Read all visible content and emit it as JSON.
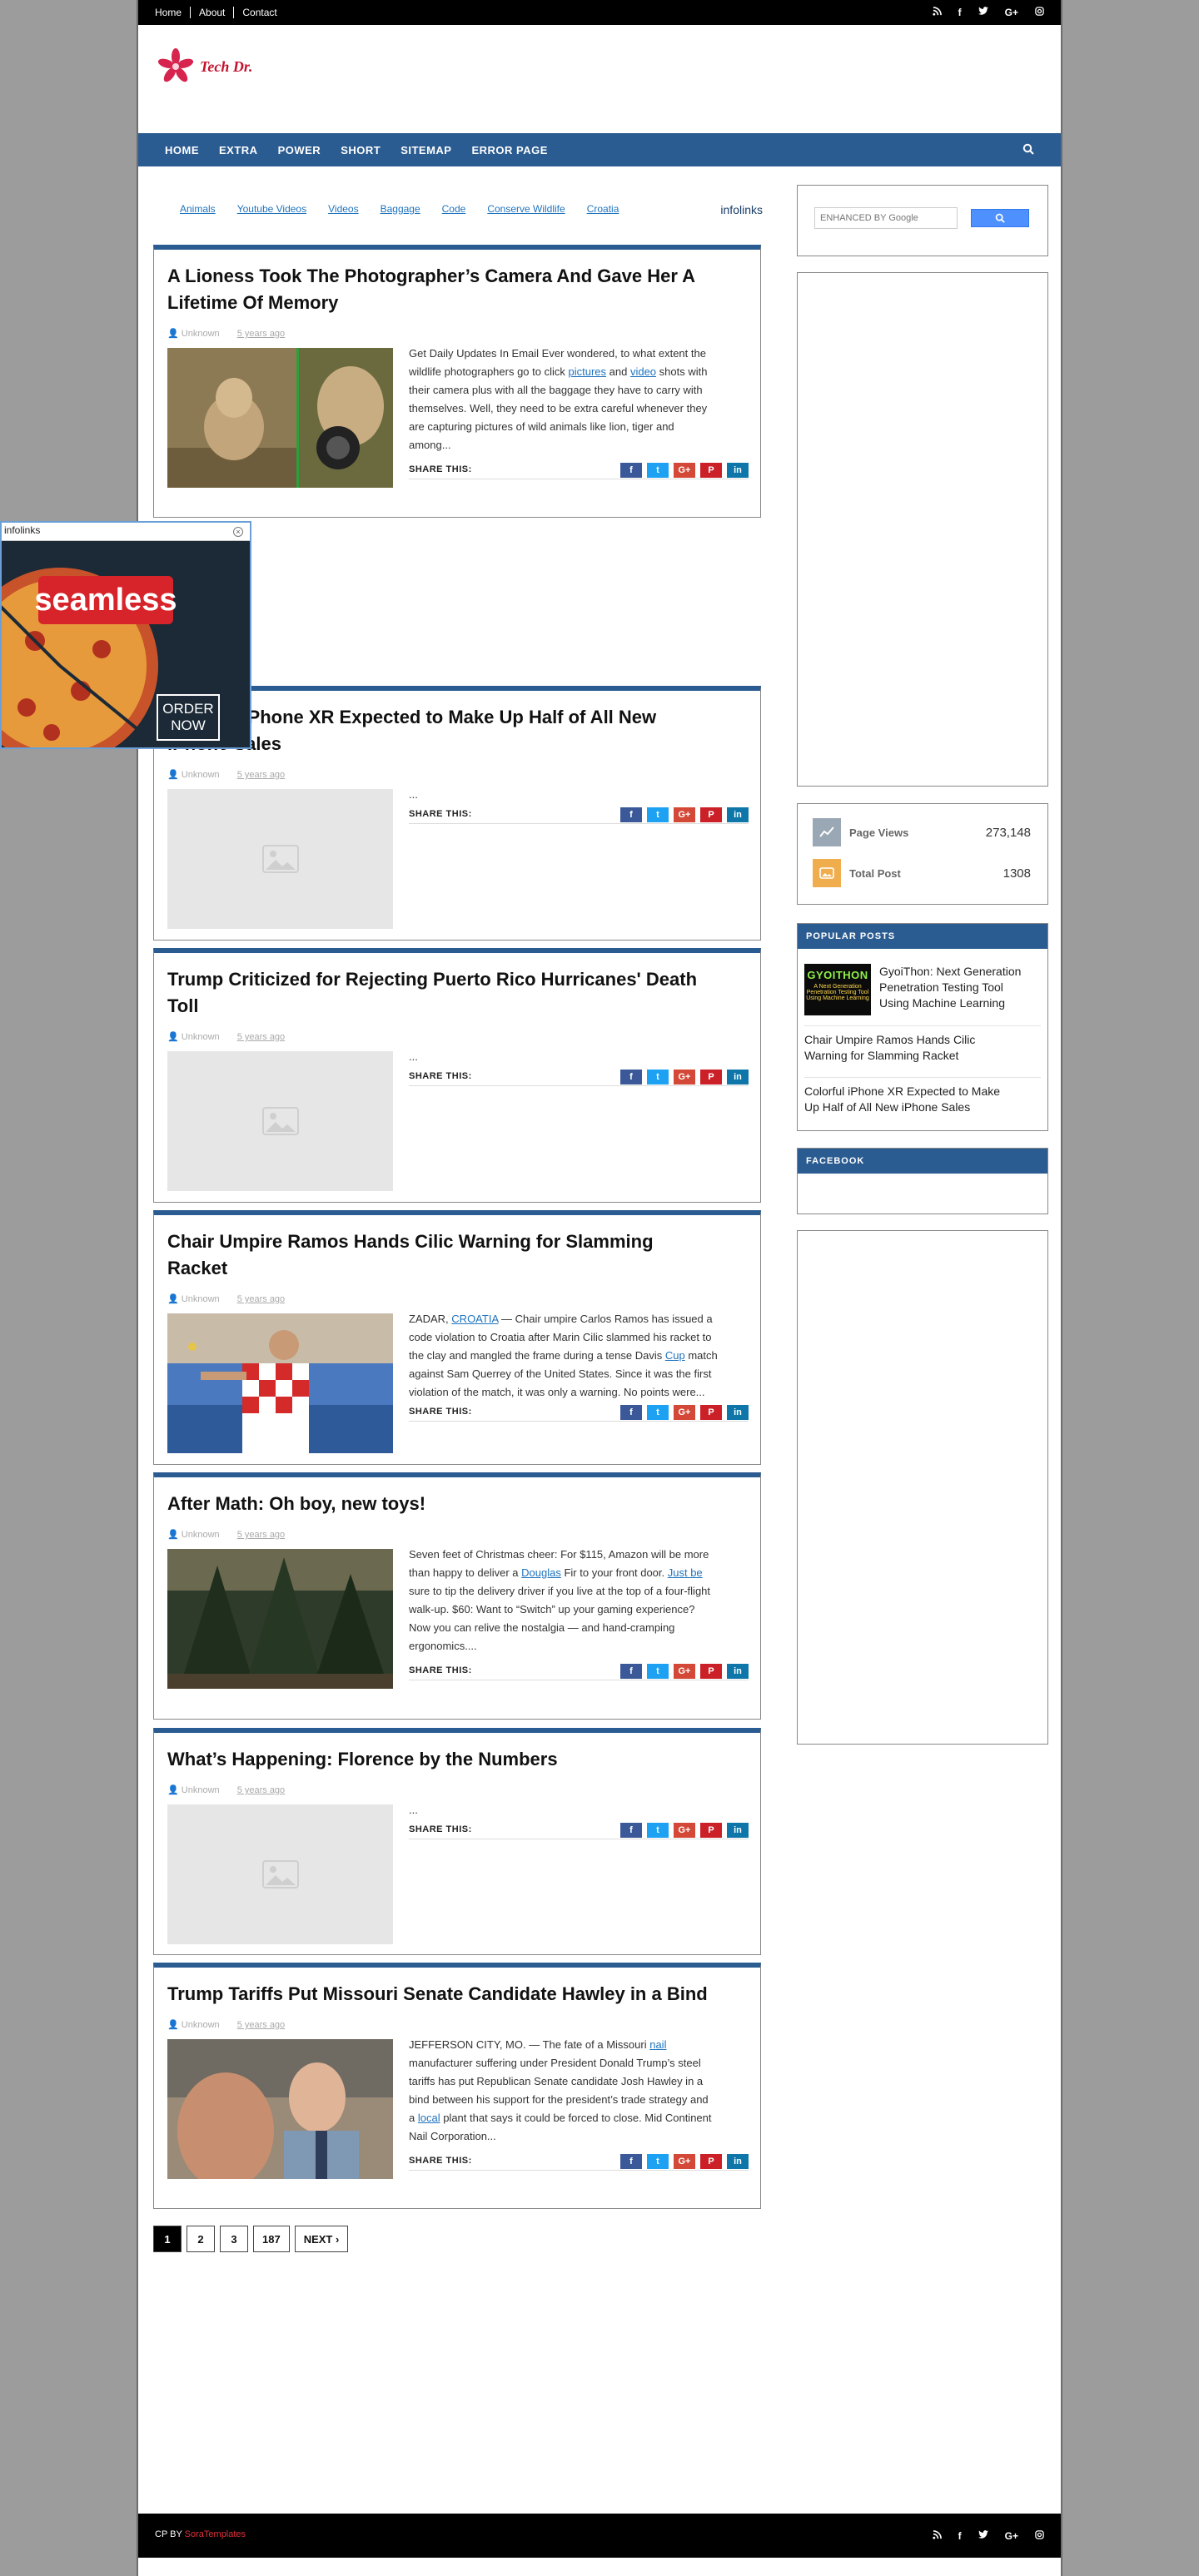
{
  "topbar": {
    "links": [
      "Home",
      "About",
      "Contact"
    ],
    "social_icons": [
      "rss-icon",
      "facebook-icon",
      "twitter-icon",
      "google-plus-icon",
      "instagram-icon"
    ]
  },
  "logo": {
    "text": "Tech Dr."
  },
  "nav": {
    "items": [
      "HOME",
      "EXTRA",
      "POWER",
      "SHORT",
      "SITEMAP",
      "ERROR PAGE"
    ],
    "search_icon": "search-icon"
  },
  "tags": {
    "items": [
      "Animals",
      "Youtube Videos",
      "Videos",
      "Baggage",
      "Code",
      "Conserve Wildlife",
      "Croatia"
    ],
    "brand": "infolinks"
  },
  "share_label": "SHARE THIS:",
  "posts": [
    {
      "title_l1": "A Lioness Took The Photographer’s Camera And Gave Her A",
      "title_l2": "Lifetime Of Memory",
      "author": "Unknown",
      "date": "5 years ago",
      "summary": [
        "Get Daily Updates In Email Ever wondered, to what extent the",
        [
          "wildlife photographers go to click ",
          "pictures",
          " and ",
          "video",
          " shots with"
        ],
        "their camera plus with all the baggage they have to carry with",
        "themselves. Well, they need to be extra careful whenever they",
        "are capturing pictures of wild animals like lion, tiger and",
        "among..."
      ]
    },
    {
      "title_l1": "Colorful iPhone XR Expected to Make Up Half of All New",
      "title_l2": "iPhone Sales",
      "author": "Unknown",
      "date": "5 years ago",
      "summary": [
        "..."
      ]
    },
    {
      "title_l1": "Trump Criticized for Rejecting Puerto Rico Hurricanes' Death",
      "title_l2": "Toll",
      "author": "Unknown",
      "date": "5 years ago",
      "summary": [
        "..."
      ]
    },
    {
      "title_l1": "Chair Umpire Ramos Hands Cilic Warning for Slamming",
      "title_l2": "Racket",
      "author": "Unknown",
      "date": "5 years ago",
      "summary": [
        [
          "ZADAR, ",
          "CROATIA",
          " —  Chair umpire Carlos Ramos has issued a"
        ],
        "code violation to Croatia after Marin Cilic slammed his racket to",
        [
          "the clay and mangled the frame during a tense Davis ",
          "Cup",
          " match"
        ],
        "against Sam Querrey of the United States. Since it was the first",
        "violation of the match, it was only a warning. No points were..."
      ]
    },
    {
      "title_l1": "After Math: Oh boy, new toys!",
      "title_l2": "",
      "author": "Unknown",
      "date": "5 years ago",
      "summary": [
        "Seven feet of Christmas cheer: For $115, Amazon will be more",
        [
          "than happy to deliver a ",
          "Douglas",
          " Fir to your front door. ",
          "Just be"
        ],
        "sure to tip the delivery driver if you live at the top of a four-flight",
        "walk-up. $60: Want to “Switch” up your gaming experience?",
        "Now you can relive the nostalgia — and hand-cramping",
        "ergonomics...."
      ]
    },
    {
      "title_l1": "What’s Happening: Florence by the Numbers",
      "title_l2": "",
      "author": "Unknown",
      "date": "5 years ago",
      "summary": [
        "..."
      ]
    },
    {
      "title_l1": "Trump Tariffs Put Missouri Senate Candidate Hawley in a Bind",
      "title_l2": "",
      "author": "Unknown",
      "date": "5 years ago",
      "summary": [
        [
          "JEFFERSON CITY, MO. —  The fate of a Missouri ",
          "nail"
        ],
        "manufacturer suffering under President Donald Trump’s steel",
        "tariffs has put Republican Senate candidate Josh Hawley in a",
        "bind between his support for the president’s trade strategy and",
        [
          "a ",
          "local",
          " plant that says it could be forced to close. Mid Continent"
        ],
        "Nail Corporation..."
      ]
    }
  ],
  "ad": {
    "header": "infolinks",
    "brand": "seamless",
    "cta_l1": "ORDER",
    "cta_l2": "NOW"
  },
  "sidebar": {
    "search_placeholder": "ENHANCED BY Google",
    "stats": [
      {
        "label": "Page Views",
        "value": "273,148",
        "color": "#9aa7b4"
      },
      {
        "label": "Total Post",
        "value": "1308",
        "color": "#f0ad4e"
      }
    ],
    "popular_title": "POPULAR POSTS",
    "popular": [
      {
        "l1": "GyoiThon: Next Generation",
        "l2": "Penetration Testing Tool",
        "l3": "Using Machine Learning"
      },
      {
        "l1": "Chair Umpire Ramos Hands Cilic",
        "l2": "Warning for Slamming Racket"
      },
      {
        "l1": "Colorful iPhone XR Expected to Make",
        "l2": "Up Half of All New iPhone Sales"
      }
    ],
    "gyoithon_thumb": {
      "title": "GYOITHON",
      "sub1": "A Next Generation",
      "sub2": "Penetration Testing Tool",
      "sub3": "Using Machine Learning"
    },
    "facebook_title": "FACEBOOK"
  },
  "pagination": [
    "1",
    "2",
    "3",
    "187",
    "NEXT ›"
  ],
  "footer": {
    "cp": "CP BY ",
    "brand": "SoraTemplates"
  },
  "colors": {
    "nav": "#2b5c91",
    "accent_red": "#e0323a",
    "link": "#1e73be"
  }
}
